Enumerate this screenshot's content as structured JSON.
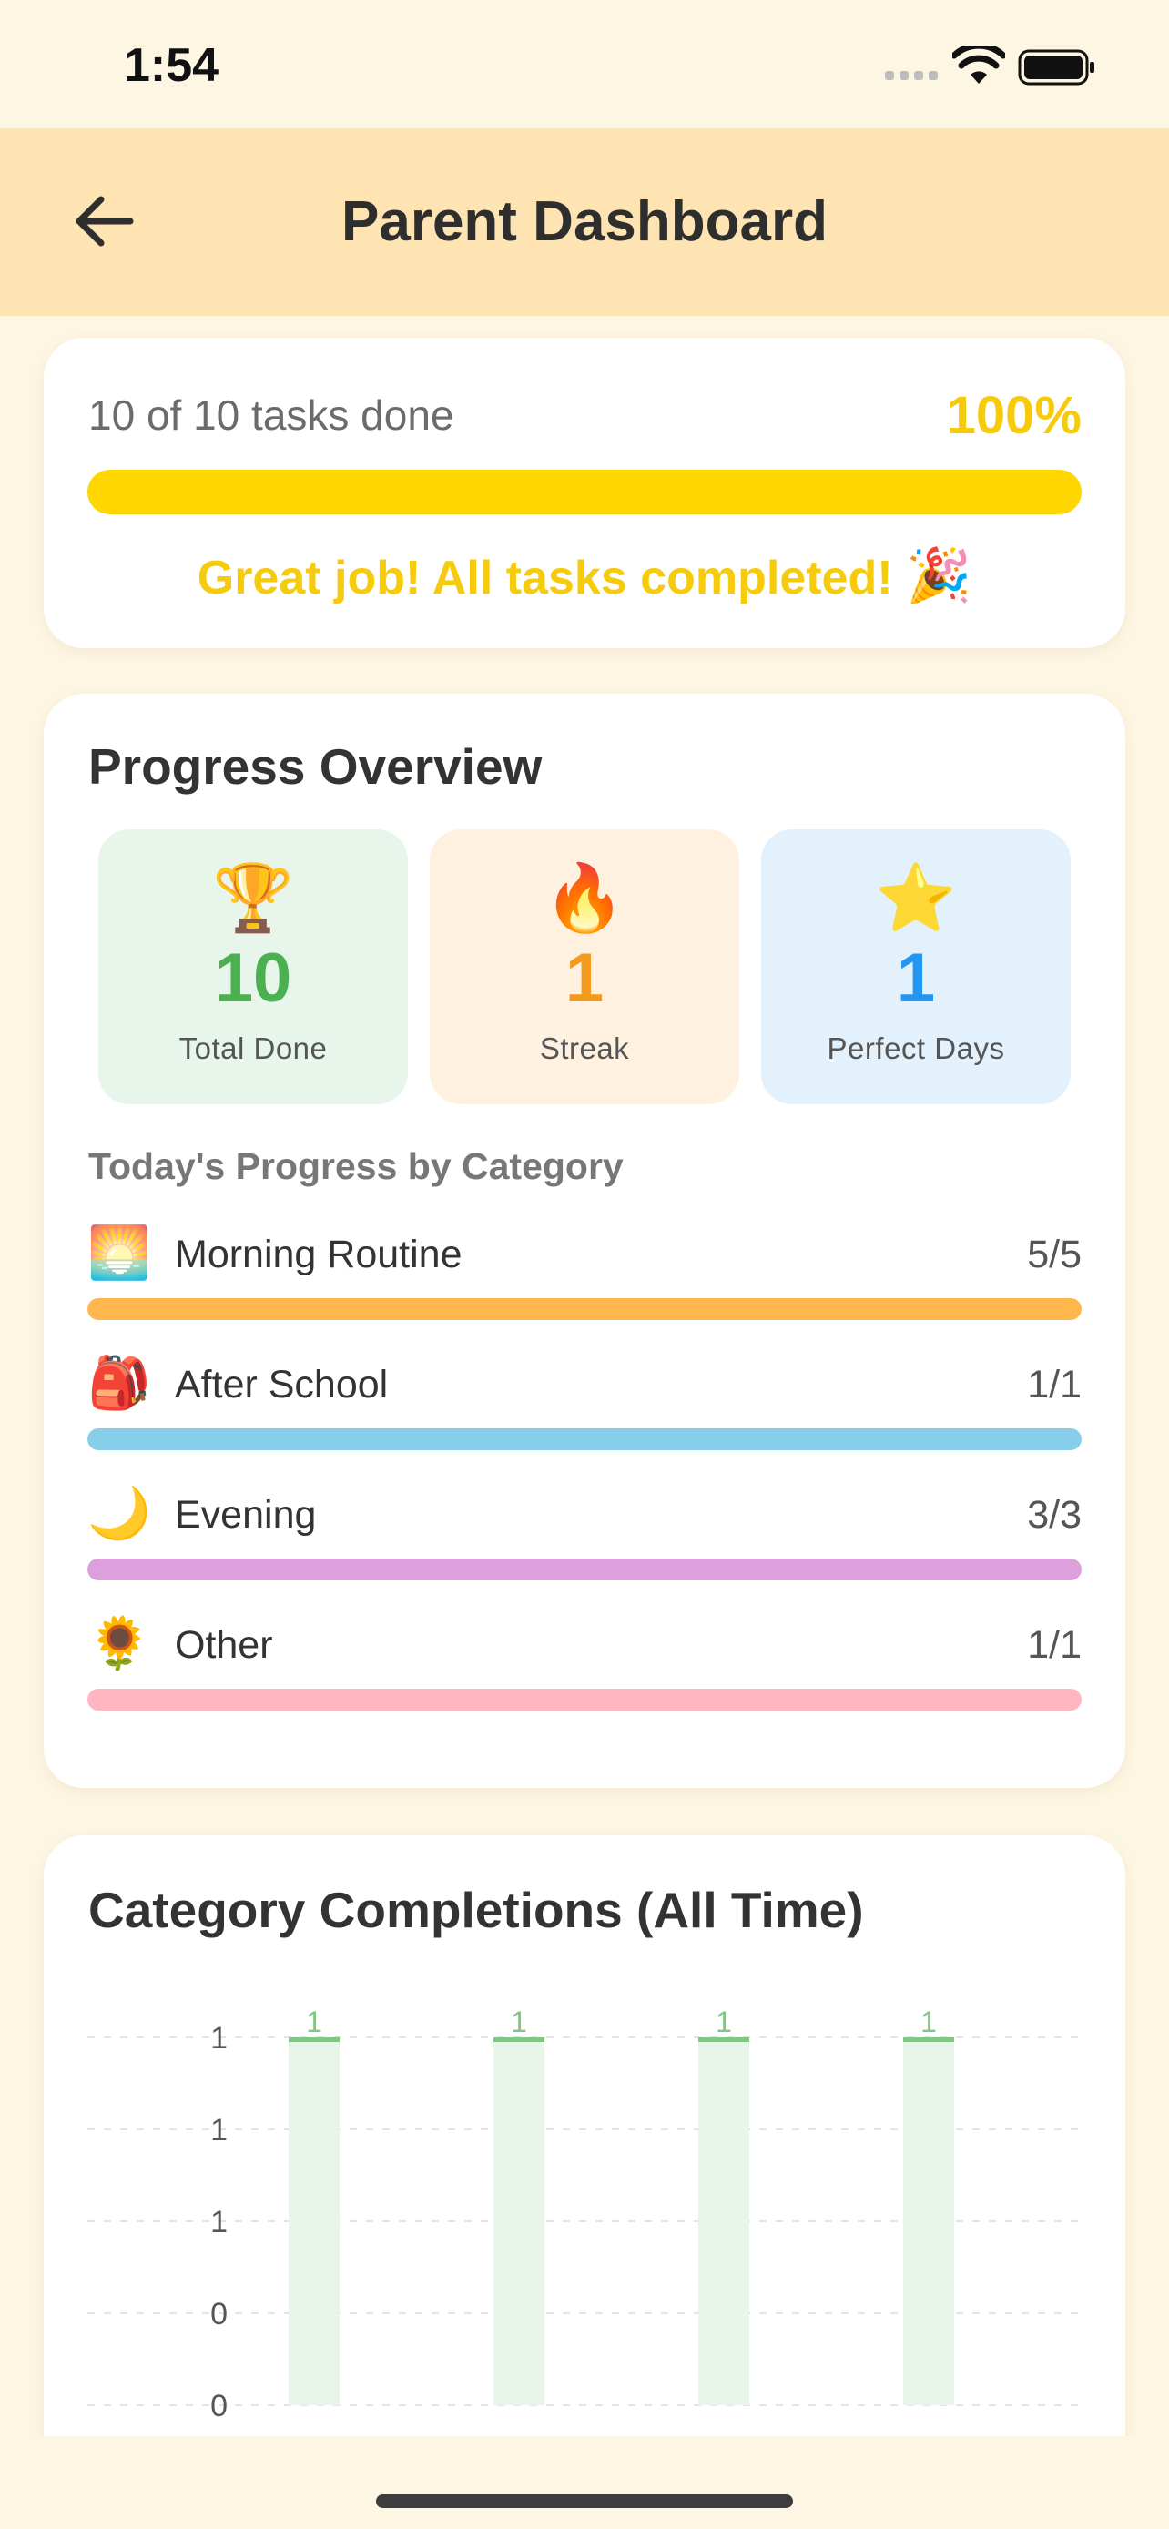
{
  "status_bar": {
    "time": "1:54",
    "signal_icon": "cellular-signal-icon",
    "wifi_icon": "wifi-icon",
    "battery_icon": "battery-full-icon"
  },
  "header": {
    "back_icon": "arrow-left-icon",
    "title": "Parent Dashboard",
    "background_color": "#FEE4B3"
  },
  "summary": {
    "tasks_done": "10 of 10 tasks done",
    "percent_label": "100%",
    "progress": 1.0,
    "progress_color": "#FFD600",
    "message": "Great job! All tasks completed!",
    "message_emoji": "🎉"
  },
  "overview": {
    "title": "Progress Overview",
    "stats": [
      {
        "emoji": "🏆",
        "value": "10",
        "label": "Total Done",
        "bg": "#E8F5EA",
        "color": "#4CAF50"
      },
      {
        "emoji": "🔥",
        "value": "1",
        "label": "Streak",
        "bg": "#FFF1DF",
        "color": "#F29A1E"
      },
      {
        "emoji": "⭐",
        "value": "1",
        "label": "Perfect Days",
        "bg": "#E3F1FD",
        "color": "#2196F3"
      }
    ],
    "category_title": "Today's Progress by Category",
    "categories": [
      {
        "emoji": "🌅",
        "name": "Morning Routine",
        "count": "5/5",
        "progress": 1.0,
        "color": "#FFB74D"
      },
      {
        "emoji": "🎒",
        "name": "After School",
        "count": "1/1",
        "progress": 1.0,
        "color": "#87CEEB"
      },
      {
        "emoji": "🌙",
        "name": "Evening",
        "count": "3/3",
        "progress": 1.0,
        "color": "#DDA0DD"
      },
      {
        "emoji": "🌻",
        "name": "Other",
        "count": "1/1",
        "progress": 1.0,
        "color": "#FFB6C1"
      }
    ]
  },
  "completions": {
    "title": "Category Completions (All Time)"
  },
  "chart_data": {
    "type": "bar",
    "title": "Category Completions (All Time)",
    "categories": [
      "",
      "",
      "",
      ""
    ],
    "values": [
      1,
      1,
      1,
      1
    ],
    "data_labels": [
      "1",
      "1",
      "1",
      "1"
    ],
    "y_tick_labels": [
      "1",
      "1",
      "1",
      "0",
      "0"
    ],
    "ylim": [
      0,
      1
    ],
    "grid": true,
    "bar_fill_color": "#E8F5EA",
    "bar_top_color": "#81C784",
    "label_color": "#81C784"
  }
}
